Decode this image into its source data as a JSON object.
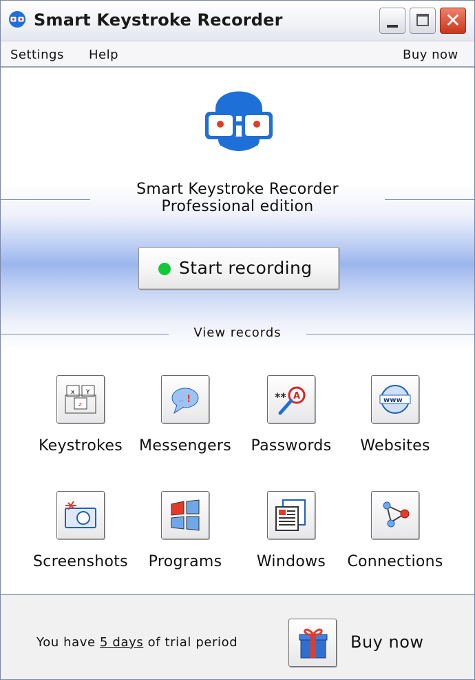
{
  "window": {
    "title": "Smart Keystroke Recorder",
    "icons": {
      "app": "app-eyes-icon",
      "minimize": "minimize-icon",
      "maximize": "maximize-icon",
      "close": "close-icon"
    },
    "close_glyph": "✕"
  },
  "menu": {
    "settings": "Settings",
    "help": "Help",
    "buy_now": "Buy now"
  },
  "product": {
    "name": "Smart Keystroke Recorder",
    "edition": "Professional edition",
    "logo_icon": "mascot-face-icon"
  },
  "recording": {
    "start_label": "Start recording",
    "status_color": "#12c83a"
  },
  "records": {
    "heading": "View records",
    "items": [
      {
        "label": "Keystrokes",
        "icon": "keyboard-keys-icon"
      },
      {
        "label": "Messengers",
        "icon": "chat-bubble-icon"
      },
      {
        "label": "Passwords",
        "icon": "password-magnifier-icon"
      },
      {
        "label": "Websites",
        "icon": "www-globe-icon"
      },
      {
        "label": "Screenshots",
        "icon": "camera-icon"
      },
      {
        "label": "Programs",
        "icon": "windows-flag-icon"
      },
      {
        "label": "Windows",
        "icon": "document-window-icon"
      },
      {
        "label": "Connections",
        "icon": "network-nodes-icon"
      }
    ]
  },
  "footer": {
    "trial_prefix": "You have ",
    "trial_days": "5 days",
    "trial_suffix": " of trial period",
    "buy_label": "Buy now",
    "buy_icon": "gift-box-icon"
  },
  "colors": {
    "accent_blue": "#1f6fd8",
    "mascot_eye": "#e23b2a"
  }
}
